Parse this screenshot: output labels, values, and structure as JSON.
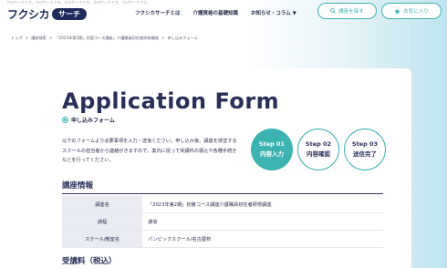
{
  "header": {
    "top_note": "ﾌｸｼｶサーチです。ﾌｸｼｶサーチです。ﾌｸｼｶサーチです。ﾌｸｼｶサーチです。ﾌｸｼｶサーチです。",
    "logo_main": "フクシカ",
    "logo_badge": "サーチ",
    "nav": [
      "フクシカサーチとは",
      "介護資格の基礎知識",
      "お知らせ・コラム ▼"
    ],
    "course_button": "講座を探す",
    "fav_button": "お気に入り"
  },
  "breadcrumb": [
    "トップ",
    ">",
    "講座検索",
    ">",
    "「2023年第2期」初度コース講座」介護職員初任者研修講座",
    ">",
    "申し込みフォーム"
  ],
  "page": {
    "title": "Application Form",
    "subtitle": "申し込みフォーム",
    "intro": "以下のフォームより必要事項を入力・送信ください。申し込み後、講座を運営するスクールの担当者から連絡がきますので、案内に従って受講料の振込や各種手続きなどを行ってください。"
  },
  "steps": [
    {
      "num": "Step 01",
      "label": "内容入力",
      "active": true
    },
    {
      "num": "Step 02",
      "label": "内容確認",
      "active": false
    },
    {
      "num": "Step 03",
      "label": "送信完了",
      "active": false
    }
  ],
  "course_info": {
    "title": "講座情報",
    "rows": [
      {
        "label": "講座名",
        "value": "「2023年第2期」初度コース講座介護職員初任者研修講座"
      },
      {
        "label": "通程",
        "value": "通信"
      },
      {
        "label": "スクール/教室名",
        "value": "パンピックスクール/名古屋校"
      }
    ]
  },
  "fee_section": {
    "title": "受講料（税込）"
  },
  "colors": {
    "accent": "#3bb3b0",
    "navy": "#2a2f5a"
  }
}
